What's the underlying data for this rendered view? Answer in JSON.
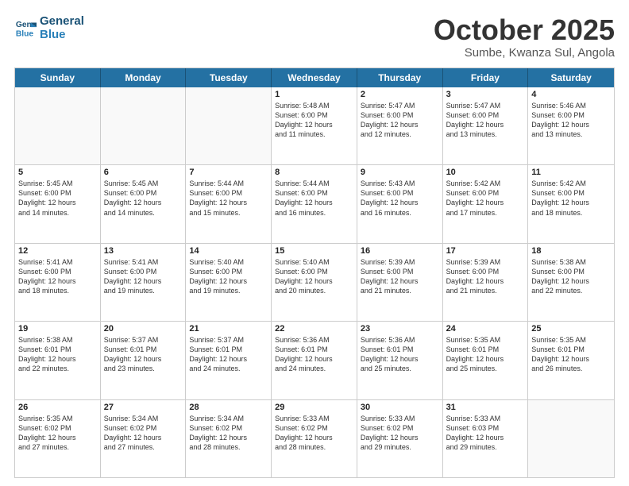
{
  "logo": {
    "line1": "General",
    "line2": "Blue"
  },
  "header": {
    "month": "October 2025",
    "location": "Sumbe, Kwanza Sul, Angola"
  },
  "days": [
    "Sunday",
    "Monday",
    "Tuesday",
    "Wednesday",
    "Thursday",
    "Friday",
    "Saturday"
  ],
  "weeks": [
    [
      {
        "day": "",
        "lines": []
      },
      {
        "day": "",
        "lines": []
      },
      {
        "day": "",
        "lines": []
      },
      {
        "day": "1",
        "lines": [
          "Sunrise: 5:48 AM",
          "Sunset: 6:00 PM",
          "Daylight: 12 hours",
          "and 11 minutes."
        ]
      },
      {
        "day": "2",
        "lines": [
          "Sunrise: 5:47 AM",
          "Sunset: 6:00 PM",
          "Daylight: 12 hours",
          "and 12 minutes."
        ]
      },
      {
        "day": "3",
        "lines": [
          "Sunrise: 5:47 AM",
          "Sunset: 6:00 PM",
          "Daylight: 12 hours",
          "and 13 minutes."
        ]
      },
      {
        "day": "4",
        "lines": [
          "Sunrise: 5:46 AM",
          "Sunset: 6:00 PM",
          "Daylight: 12 hours",
          "and 13 minutes."
        ]
      }
    ],
    [
      {
        "day": "5",
        "lines": [
          "Sunrise: 5:45 AM",
          "Sunset: 6:00 PM",
          "Daylight: 12 hours",
          "and 14 minutes."
        ]
      },
      {
        "day": "6",
        "lines": [
          "Sunrise: 5:45 AM",
          "Sunset: 6:00 PM",
          "Daylight: 12 hours",
          "and 14 minutes."
        ]
      },
      {
        "day": "7",
        "lines": [
          "Sunrise: 5:44 AM",
          "Sunset: 6:00 PM",
          "Daylight: 12 hours",
          "and 15 minutes."
        ]
      },
      {
        "day": "8",
        "lines": [
          "Sunrise: 5:44 AM",
          "Sunset: 6:00 PM",
          "Daylight: 12 hours",
          "and 16 minutes."
        ]
      },
      {
        "day": "9",
        "lines": [
          "Sunrise: 5:43 AM",
          "Sunset: 6:00 PM",
          "Daylight: 12 hours",
          "and 16 minutes."
        ]
      },
      {
        "day": "10",
        "lines": [
          "Sunrise: 5:42 AM",
          "Sunset: 6:00 PM",
          "Daylight: 12 hours",
          "and 17 minutes."
        ]
      },
      {
        "day": "11",
        "lines": [
          "Sunrise: 5:42 AM",
          "Sunset: 6:00 PM",
          "Daylight: 12 hours",
          "and 18 minutes."
        ]
      }
    ],
    [
      {
        "day": "12",
        "lines": [
          "Sunrise: 5:41 AM",
          "Sunset: 6:00 PM",
          "Daylight: 12 hours",
          "and 18 minutes."
        ]
      },
      {
        "day": "13",
        "lines": [
          "Sunrise: 5:41 AM",
          "Sunset: 6:00 PM",
          "Daylight: 12 hours",
          "and 19 minutes."
        ]
      },
      {
        "day": "14",
        "lines": [
          "Sunrise: 5:40 AM",
          "Sunset: 6:00 PM",
          "Daylight: 12 hours",
          "and 19 minutes."
        ]
      },
      {
        "day": "15",
        "lines": [
          "Sunrise: 5:40 AM",
          "Sunset: 6:00 PM",
          "Daylight: 12 hours",
          "and 20 minutes."
        ]
      },
      {
        "day": "16",
        "lines": [
          "Sunrise: 5:39 AM",
          "Sunset: 6:00 PM",
          "Daylight: 12 hours",
          "and 21 minutes."
        ]
      },
      {
        "day": "17",
        "lines": [
          "Sunrise: 5:39 AM",
          "Sunset: 6:00 PM",
          "Daylight: 12 hours",
          "and 21 minutes."
        ]
      },
      {
        "day": "18",
        "lines": [
          "Sunrise: 5:38 AM",
          "Sunset: 6:00 PM",
          "Daylight: 12 hours",
          "and 22 minutes."
        ]
      }
    ],
    [
      {
        "day": "19",
        "lines": [
          "Sunrise: 5:38 AM",
          "Sunset: 6:01 PM",
          "Daylight: 12 hours",
          "and 22 minutes."
        ]
      },
      {
        "day": "20",
        "lines": [
          "Sunrise: 5:37 AM",
          "Sunset: 6:01 PM",
          "Daylight: 12 hours",
          "and 23 minutes."
        ]
      },
      {
        "day": "21",
        "lines": [
          "Sunrise: 5:37 AM",
          "Sunset: 6:01 PM",
          "Daylight: 12 hours",
          "and 24 minutes."
        ]
      },
      {
        "day": "22",
        "lines": [
          "Sunrise: 5:36 AM",
          "Sunset: 6:01 PM",
          "Daylight: 12 hours",
          "and 24 minutes."
        ]
      },
      {
        "day": "23",
        "lines": [
          "Sunrise: 5:36 AM",
          "Sunset: 6:01 PM",
          "Daylight: 12 hours",
          "and 25 minutes."
        ]
      },
      {
        "day": "24",
        "lines": [
          "Sunrise: 5:35 AM",
          "Sunset: 6:01 PM",
          "Daylight: 12 hours",
          "and 25 minutes."
        ]
      },
      {
        "day": "25",
        "lines": [
          "Sunrise: 5:35 AM",
          "Sunset: 6:01 PM",
          "Daylight: 12 hours",
          "and 26 minutes."
        ]
      }
    ],
    [
      {
        "day": "26",
        "lines": [
          "Sunrise: 5:35 AM",
          "Sunset: 6:02 PM",
          "Daylight: 12 hours",
          "and 27 minutes."
        ]
      },
      {
        "day": "27",
        "lines": [
          "Sunrise: 5:34 AM",
          "Sunset: 6:02 PM",
          "Daylight: 12 hours",
          "and 27 minutes."
        ]
      },
      {
        "day": "28",
        "lines": [
          "Sunrise: 5:34 AM",
          "Sunset: 6:02 PM",
          "Daylight: 12 hours",
          "and 28 minutes."
        ]
      },
      {
        "day": "29",
        "lines": [
          "Sunrise: 5:33 AM",
          "Sunset: 6:02 PM",
          "Daylight: 12 hours",
          "and 28 minutes."
        ]
      },
      {
        "day": "30",
        "lines": [
          "Sunrise: 5:33 AM",
          "Sunset: 6:02 PM",
          "Daylight: 12 hours",
          "and 29 minutes."
        ]
      },
      {
        "day": "31",
        "lines": [
          "Sunrise: 5:33 AM",
          "Sunset: 6:03 PM",
          "Daylight: 12 hours",
          "and 29 minutes."
        ]
      },
      {
        "day": "",
        "lines": []
      }
    ]
  ]
}
